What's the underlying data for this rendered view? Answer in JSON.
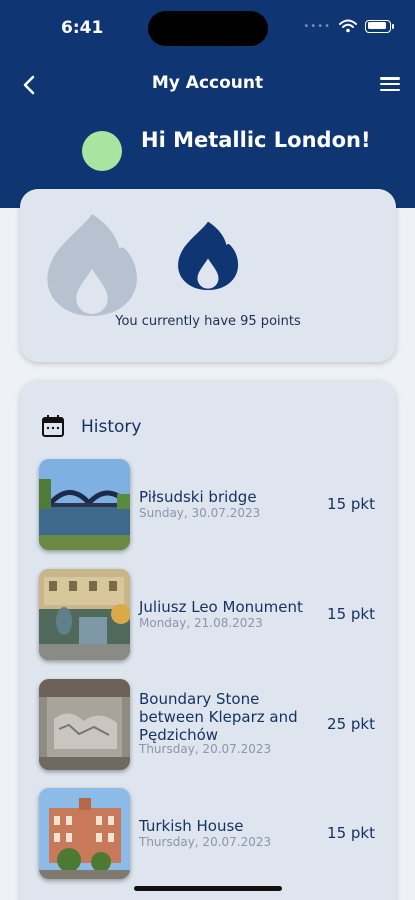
{
  "status_bar": {
    "time": "6:41",
    "signal": "••••"
  },
  "nav": {
    "title": "My Account"
  },
  "profile": {
    "greeting": "Hi Metallic London!",
    "avatar_color": "#a8e6a0"
  },
  "points": {
    "text": "You currently have 95 points"
  },
  "history": {
    "title": "History",
    "items": [
      {
        "name": "Piłsudski bridge",
        "date": "Sunday, 30.07.2023",
        "points": "15 pkt"
      },
      {
        "name": "Juliusz Leo Monument",
        "date": "Monday, 21.08.2023",
        "points": "15 pkt"
      },
      {
        "name": "Boundary Stone between Kleparz and Pędzichów",
        "date": "Thursday, 20.07.2023",
        "points": "25 pkt"
      },
      {
        "name": "Turkish House",
        "date": "Thursday, 20.07.2023",
        "points": "15 pkt"
      }
    ]
  },
  "colors": {
    "header": "#0f3672",
    "card": "#dfe5ee",
    "accent": "#13325f",
    "flame_inactive": "#b7c2d0"
  }
}
